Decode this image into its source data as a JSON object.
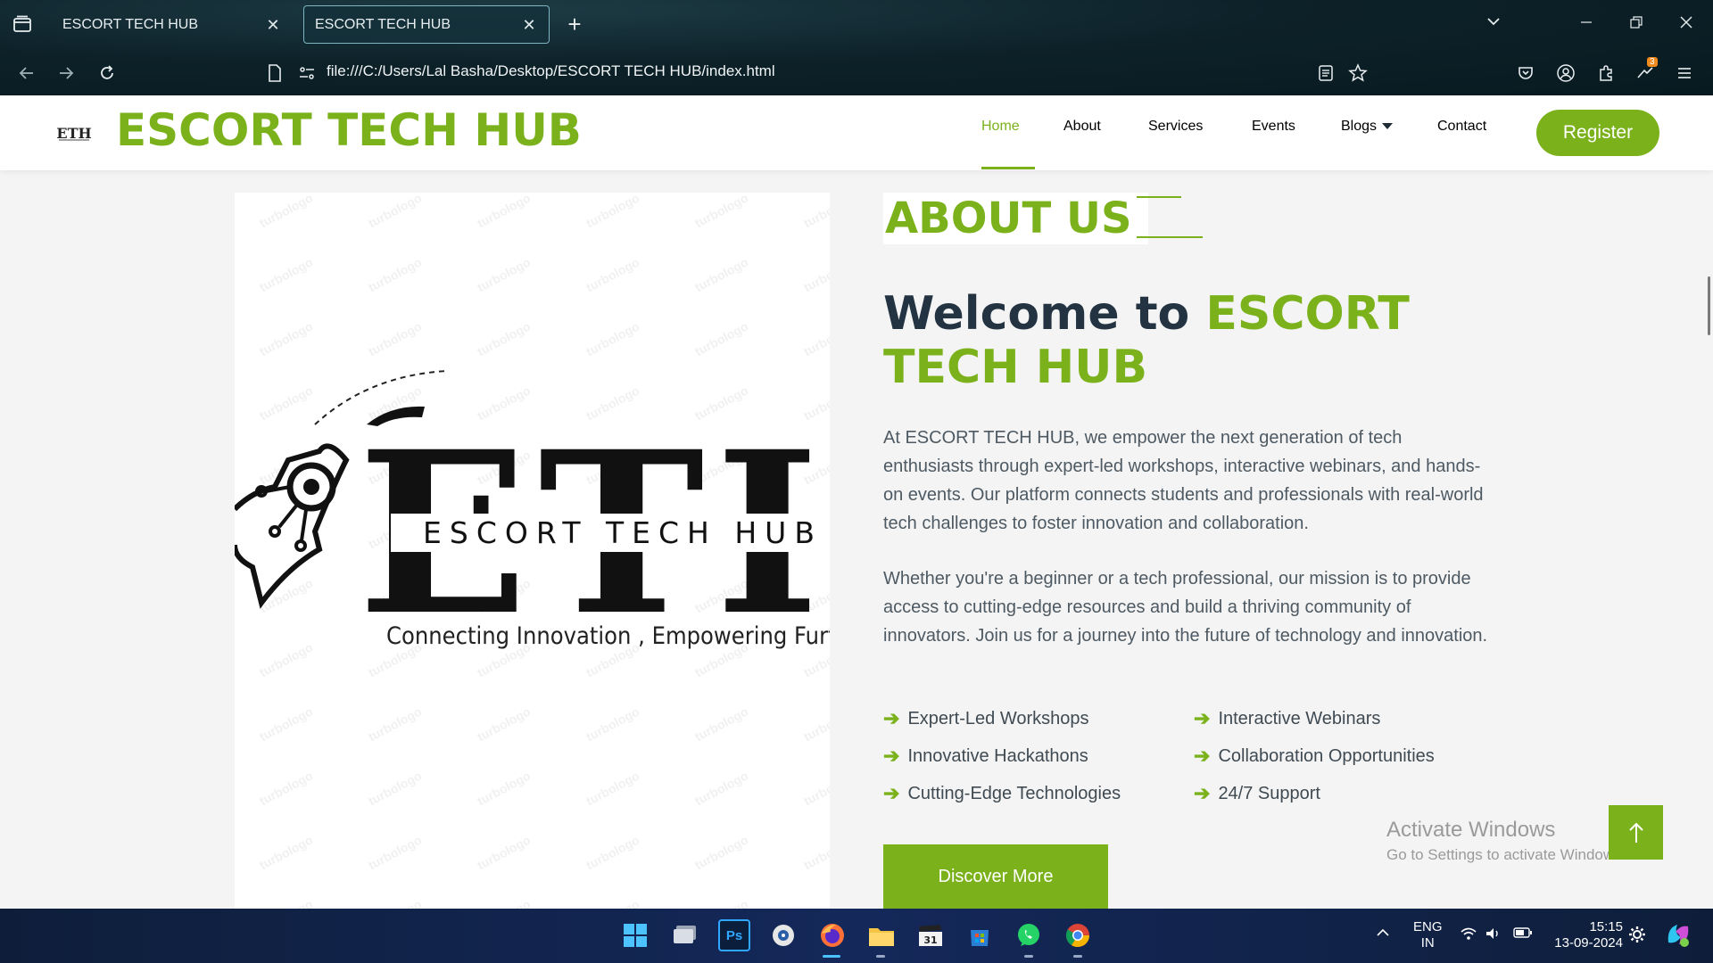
{
  "browser": {
    "tabs": [
      {
        "title": "ESCORT TECH HUB",
        "active": false
      },
      {
        "title": "ESCORT TECH HUB",
        "active": true
      }
    ],
    "url": "file:///C:/Users/Lal Basha/Desktop/ESCORT TECH HUB/index.html",
    "extension_badge": "3"
  },
  "header": {
    "brand": "ESCORT TECH HUB",
    "logo_alt": "ETH",
    "menu": [
      "Home",
      "About",
      "Services",
      "Events",
      "Blogs",
      "Contact"
    ],
    "active_menu": "Home",
    "register_label": "Register"
  },
  "about": {
    "section_label": "ABOUT US",
    "welcome_prefix": "Welcome to",
    "welcome_highlight": "ESCORT TECH HUB",
    "paragraph1": "At ESCORT TECH HUB, we empower the next generation of tech enthusiasts through expert-led workshops, interactive webinars, and hands-on events. Our platform connects students and professionals with real-world tech challenges to foster innovation and collaboration.",
    "paragraph2": "Whether you're a beginner or a tech professional, our mission is to provide access to cutting-edge resources and build a thriving community of innovators. Join us for a journey into the future of technology and innovation.",
    "features": [
      "Expert-Led Workshops",
      "Interactive Webinars",
      "Innovative Hackathons",
      "Collaboration Opportunities",
      "Cutting-Edge Technologies",
      "24/7 Support"
    ],
    "discover_label": "Discover More"
  },
  "logo_image": {
    "monogram": "ETH",
    "name": "ESCORT TECH HUB",
    "tagline": "Connecting Innovation , Empowering Furture",
    "watermark": "turbologo"
  },
  "overlay": {
    "activate_title": "Activate Windows",
    "activate_sub": "Go to Settings to activate Windows."
  },
  "taskbar": {
    "lang_top": "ENG",
    "lang_bottom": "IN",
    "time": "15:15",
    "date": "13-09-2024"
  },
  "colors": {
    "accent": "#7bb21c",
    "heading": "#233342",
    "text": "#4e5a63"
  }
}
